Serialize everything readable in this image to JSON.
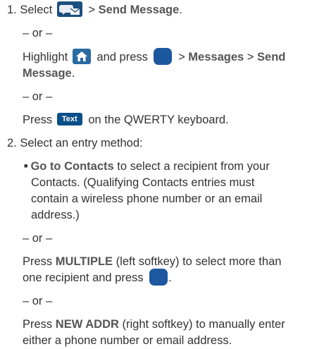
{
  "step1": {
    "number": "1.",
    "select_word": "Select",
    "sep1": ">",
    "send_message": "Send Message",
    "period": ".",
    "or1": "– or –",
    "highlight_word": "Highlight",
    "and_press": "and press",
    "sep2": ">",
    "messages": "Messages",
    "sep3": ">",
    "send": "Send",
    "message": "Message",
    "period2": ".",
    "or2": "– or –",
    "press_word": "Press",
    "text_key": "Text",
    "qwerty": "on the QWERTY keyboard."
  },
  "step2": {
    "number": "2.",
    "title": "Select an entry method:",
    "bullet_bold": "Go to Contacts",
    "bullet_line1": "to select a recipient from your",
    "bullet_line2": "Contacts. (Qualifying Contacts entries must",
    "bullet_line3": "contain a wireless phone number or an email",
    "bullet_line4": "address.)",
    "or3": "– or –",
    "press1": "Press",
    "multiple": "MULTIPLE",
    "multiple_rest": "(left softkey) to select more than",
    "multiple_line2": "one recipient and press",
    "period3": ".",
    "or4": "– or –",
    "press2": "Press",
    "newaddr": "NEW ADDR",
    "newaddr_rest": "(right softkey) to manually enter",
    "newaddr_line2": "either a phone number or email address."
  },
  "icons": {
    "messaging": "messaging-icon",
    "home": "home-icon",
    "ok_key": "menu-ok-key-icon",
    "text_key": "text-key-icon"
  },
  "colors": {
    "text": "#333333",
    "bold_text": "#555555",
    "icon_blue": "#1c57a0"
  }
}
